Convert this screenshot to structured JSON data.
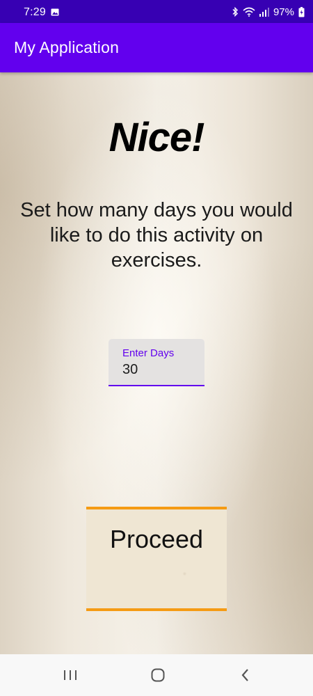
{
  "status_bar": {
    "time": "7:29",
    "battery": "97%",
    "icons": [
      "gallery-icon",
      "bluetooth-icon",
      "wifi-icon",
      "signal-icon",
      "battery-icon"
    ]
  },
  "app_bar": {
    "title": "My Application",
    "color": "#6200ee"
  },
  "main": {
    "heading": "Nice!",
    "instruction": "Set how many days you would like to do this activity on exercises.",
    "days_field": {
      "label": "Enter Days",
      "value": "30"
    },
    "proceed_label": "Proceed",
    "accent_color": "#f59b14"
  },
  "nav_bar": {
    "icons": [
      "recent-apps-icon",
      "home-icon",
      "back-icon"
    ]
  }
}
